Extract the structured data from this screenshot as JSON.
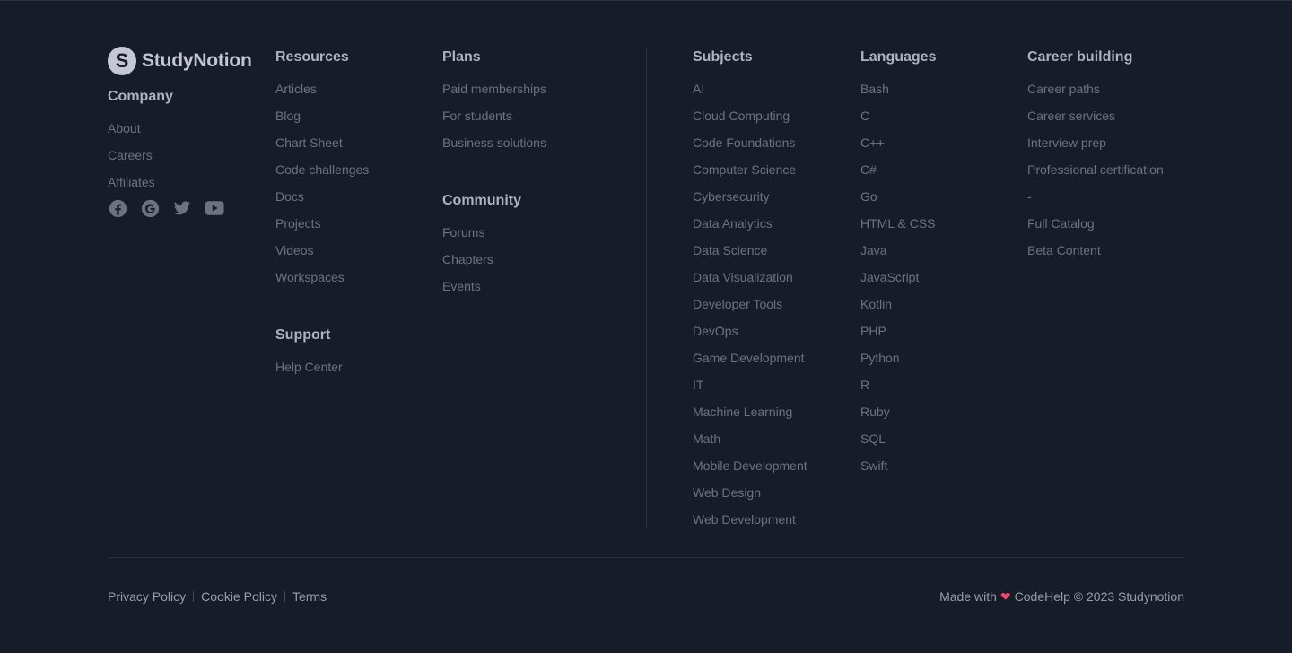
{
  "brand": {
    "logo_letter": "S",
    "name": "StudyNotion"
  },
  "company": {
    "heading": "Company",
    "links": [
      "About",
      "Careers",
      "Affiliates"
    ],
    "socials": [
      "facebook-icon",
      "google-icon",
      "twitter-icon",
      "youtube-icon"
    ]
  },
  "resources": {
    "heading": "Resources",
    "links": [
      "Articles",
      "Blog",
      "Chart Sheet",
      "Code challenges",
      "Docs",
      "Projects",
      "Videos",
      "Workspaces"
    ]
  },
  "support": {
    "heading": "Support",
    "links": [
      "Help Center"
    ]
  },
  "plans": {
    "heading": "Plans",
    "links": [
      "Paid memberships",
      "For students",
      "Business solutions"
    ]
  },
  "community": {
    "heading": "Community",
    "links": [
      "Forums",
      "Chapters",
      "Events"
    ]
  },
  "subjects": {
    "heading": "Subjects",
    "links": [
      "AI",
      "Cloud Computing",
      "Code Foundations",
      "Computer Science",
      "Cybersecurity",
      "Data Analytics",
      "Data Science",
      "Data Visualization",
      "Developer Tools",
      "DevOps",
      "Game Development",
      "IT",
      "Machine Learning",
      "Math",
      "Mobile Development",
      "Web Design",
      "Web Development"
    ]
  },
  "languages": {
    "heading": "Languages",
    "links": [
      "Bash",
      "C",
      "C++",
      "C#",
      "Go",
      "HTML & CSS",
      "Java",
      "JavaScript",
      "Kotlin",
      "PHP",
      "Python",
      "R",
      "Ruby",
      "SQL",
      "Swift"
    ]
  },
  "career": {
    "heading": "Career building",
    "links": [
      "Career paths",
      "Career services",
      "Interview prep",
      "Professional certification",
      "-",
      "Full Catalog",
      "Beta Content"
    ]
  },
  "bottom": {
    "legal": [
      "Privacy Policy",
      "Cookie Policy",
      "Terms"
    ],
    "credit_prefix": "Made with",
    "credit_heart": "❤",
    "credit_suffix": "CodeHelp © 2023 Studynotion"
  },
  "colors": {
    "background": "#161d29",
    "heading": "#afb2bf",
    "link": "#6e727f",
    "divider": "#2c333f",
    "heart": "#ef476f"
  }
}
